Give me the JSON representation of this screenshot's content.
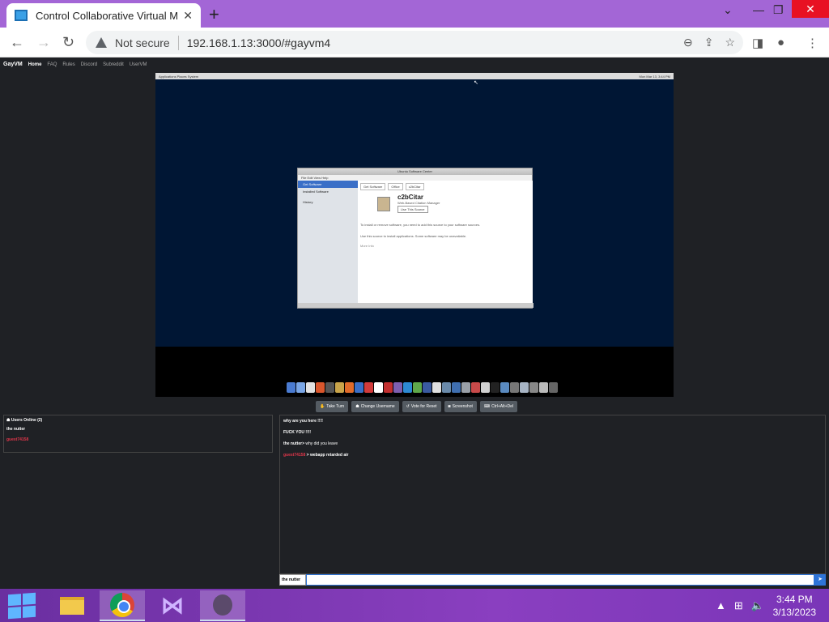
{
  "browser": {
    "tab_title": "Control Collaborative Virtual Ma",
    "not_secure": "Not secure",
    "url": "192.168.1.13:3000/#gayvm4"
  },
  "site_nav": {
    "brand": "GayVM",
    "items": [
      "Home",
      "FAQ",
      "Rules",
      "Discord",
      "Subreddit",
      "UserVM"
    ]
  },
  "vm": {
    "panel_left": "Applications  Places  System",
    "panel_right": "Mon Mar 13, 3:44 PM",
    "usc": {
      "title": "Ubuntu Software Center",
      "menu": "File  Edit  View  Help",
      "sidebar": [
        "Get Software",
        "Installed Software",
        "History"
      ],
      "crumbs": [
        "Get Software",
        "Office",
        "c2bCitar"
      ],
      "app_name": "c2bCitar",
      "app_sub": "Web-Based Citation Manager",
      "app_button": "Use This Source",
      "desc1": "To install or remove software, you need to add this source to your software sources.",
      "desc2": "Use this source to install applications. Some software may be unavailable.",
      "link": "More Info"
    },
    "dock_colors": [
      "#4a7bd1",
      "#7aa6e6",
      "#e2e2e2",
      "#d9562c",
      "#555555",
      "#c9a44a",
      "#e06b2a",
      "#3a6fc7",
      "#d23b3b",
      "#ffffff",
      "#c22f2f",
      "#7d5fb0",
      "#2d8ad3",
      "#5fa84a",
      "#3a5aa0",
      "#e0e0e0",
      "#6a8aaa",
      "#3f6fb0",
      "#9aa0a8",
      "#c84a4a",
      "#d0d0d0",
      "#222222",
      "#5a8ac0",
      "#777777",
      "#a7b4c4",
      "#888888",
      "#bbbbbb",
      "#666666"
    ]
  },
  "vm_controls": {
    "take_turn": "Take Turn",
    "change_username": "Change Username",
    "vote_reset": "Vote for Reset",
    "screenshot": "Screenshot",
    "ctrl_alt_del": "Ctrl+Alt+Del"
  },
  "users": {
    "title": "Users Online (2)",
    "list": [
      "the nutter",
      "guest74158"
    ]
  },
  "chat": {
    "messages": [
      {
        "user": "",
        "text": "why are you here !!!!"
      },
      {
        "user": "",
        "text": "FUCK YOU !!!!"
      },
      {
        "user": "the nutter",
        "text": "why did you leave"
      },
      {
        "user": "guest74158",
        "text": "webapp retarded air"
      }
    ],
    "username_label": "the nutter"
  },
  "taskbar": {
    "time": "3:44 PM",
    "date": "3/13/2023"
  }
}
